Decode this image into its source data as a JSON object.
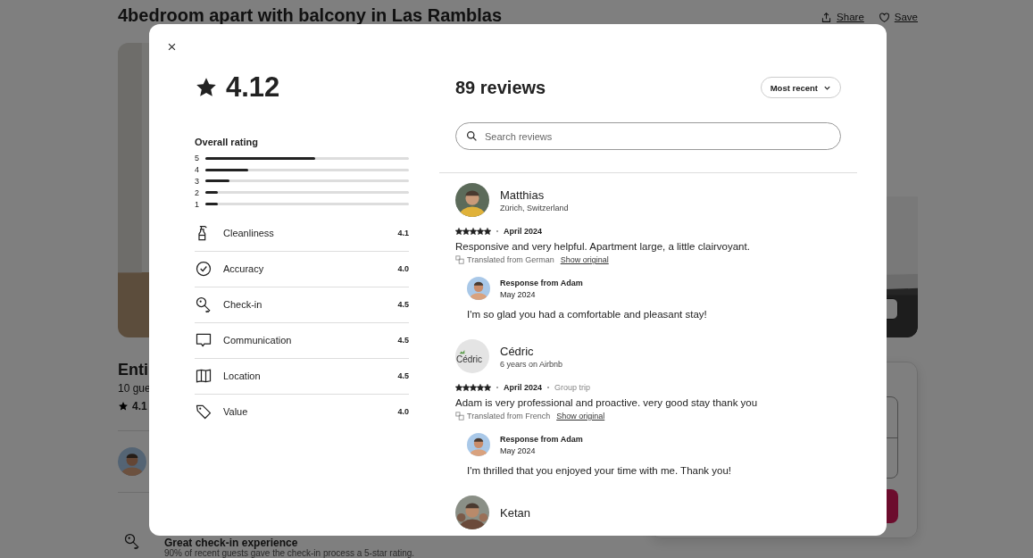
{
  "page": {
    "title": "4bedroom apart with balcony in Las Ramblas",
    "actions": [
      {
        "label": "Share"
      },
      {
        "label": "Save"
      }
    ],
    "listing": {
      "heading": "Enti",
      "guests": "10 gue",
      "rating": "4.1"
    },
    "highlight": {
      "title": "Great check-in experience",
      "text": "90% of recent guests gave the check-in process a 5-star rating."
    }
  },
  "modal": {
    "rating": "4.12",
    "overall_label": "Overall rating",
    "distribution": [
      {
        "label": "5",
        "level": 0.54
      },
      {
        "label": "4",
        "level": 0.21
      },
      {
        "label": "3",
        "level": 0.12
      },
      {
        "label": "2",
        "level": 0.06
      },
      {
        "label": "1",
        "level": 0.06
      }
    ],
    "categories": [
      {
        "label": "Cleanliness",
        "value": "4.1"
      },
      {
        "label": "Accuracy",
        "value": "4.0"
      },
      {
        "label": "Check-in",
        "value": "4.5"
      },
      {
        "label": "Communication",
        "value": "4.5"
      },
      {
        "label": "Location",
        "value": "4.5"
      },
      {
        "label": "Value",
        "value": "4.0"
      }
    ],
    "reviews_count": "89 reviews",
    "sort": "Most recent",
    "search": {
      "placeholder": "Search reviews"
    },
    "reviews": [
      {
        "name": "Matthias",
        "subtitle": "Zürich, Switzerland",
        "stars": 5,
        "date": "April 2024",
        "text": "Responsive and very helpful. Apartment large, a little clairvoyant.",
        "translation": {
          "note": "Translated from German",
          "link": "Show original"
        },
        "response": {
          "from": "Response from Adam",
          "date": "May 2024",
          "text": "I'm so glad you had a comfortable and pleasant stay!"
        }
      },
      {
        "name": "Cédric",
        "subtitle": "6 years on Airbnb",
        "avatar": {
          "kind": "broken",
          "alt": "Cédric"
        },
        "stars": 5,
        "date": "April 2024",
        "trip": "Group trip",
        "text": "Adam is very professional and proactive. very good stay thank you",
        "translation": {
          "note": "Translated from French",
          "link": "Show original"
        },
        "response": {
          "from": "Response from Adam",
          "date": "May 2024",
          "text": "I'm thrilled that you enjoyed your time with me. Thank you!"
        }
      },
      {
        "name": "Ketan"
      }
    ]
  }
}
